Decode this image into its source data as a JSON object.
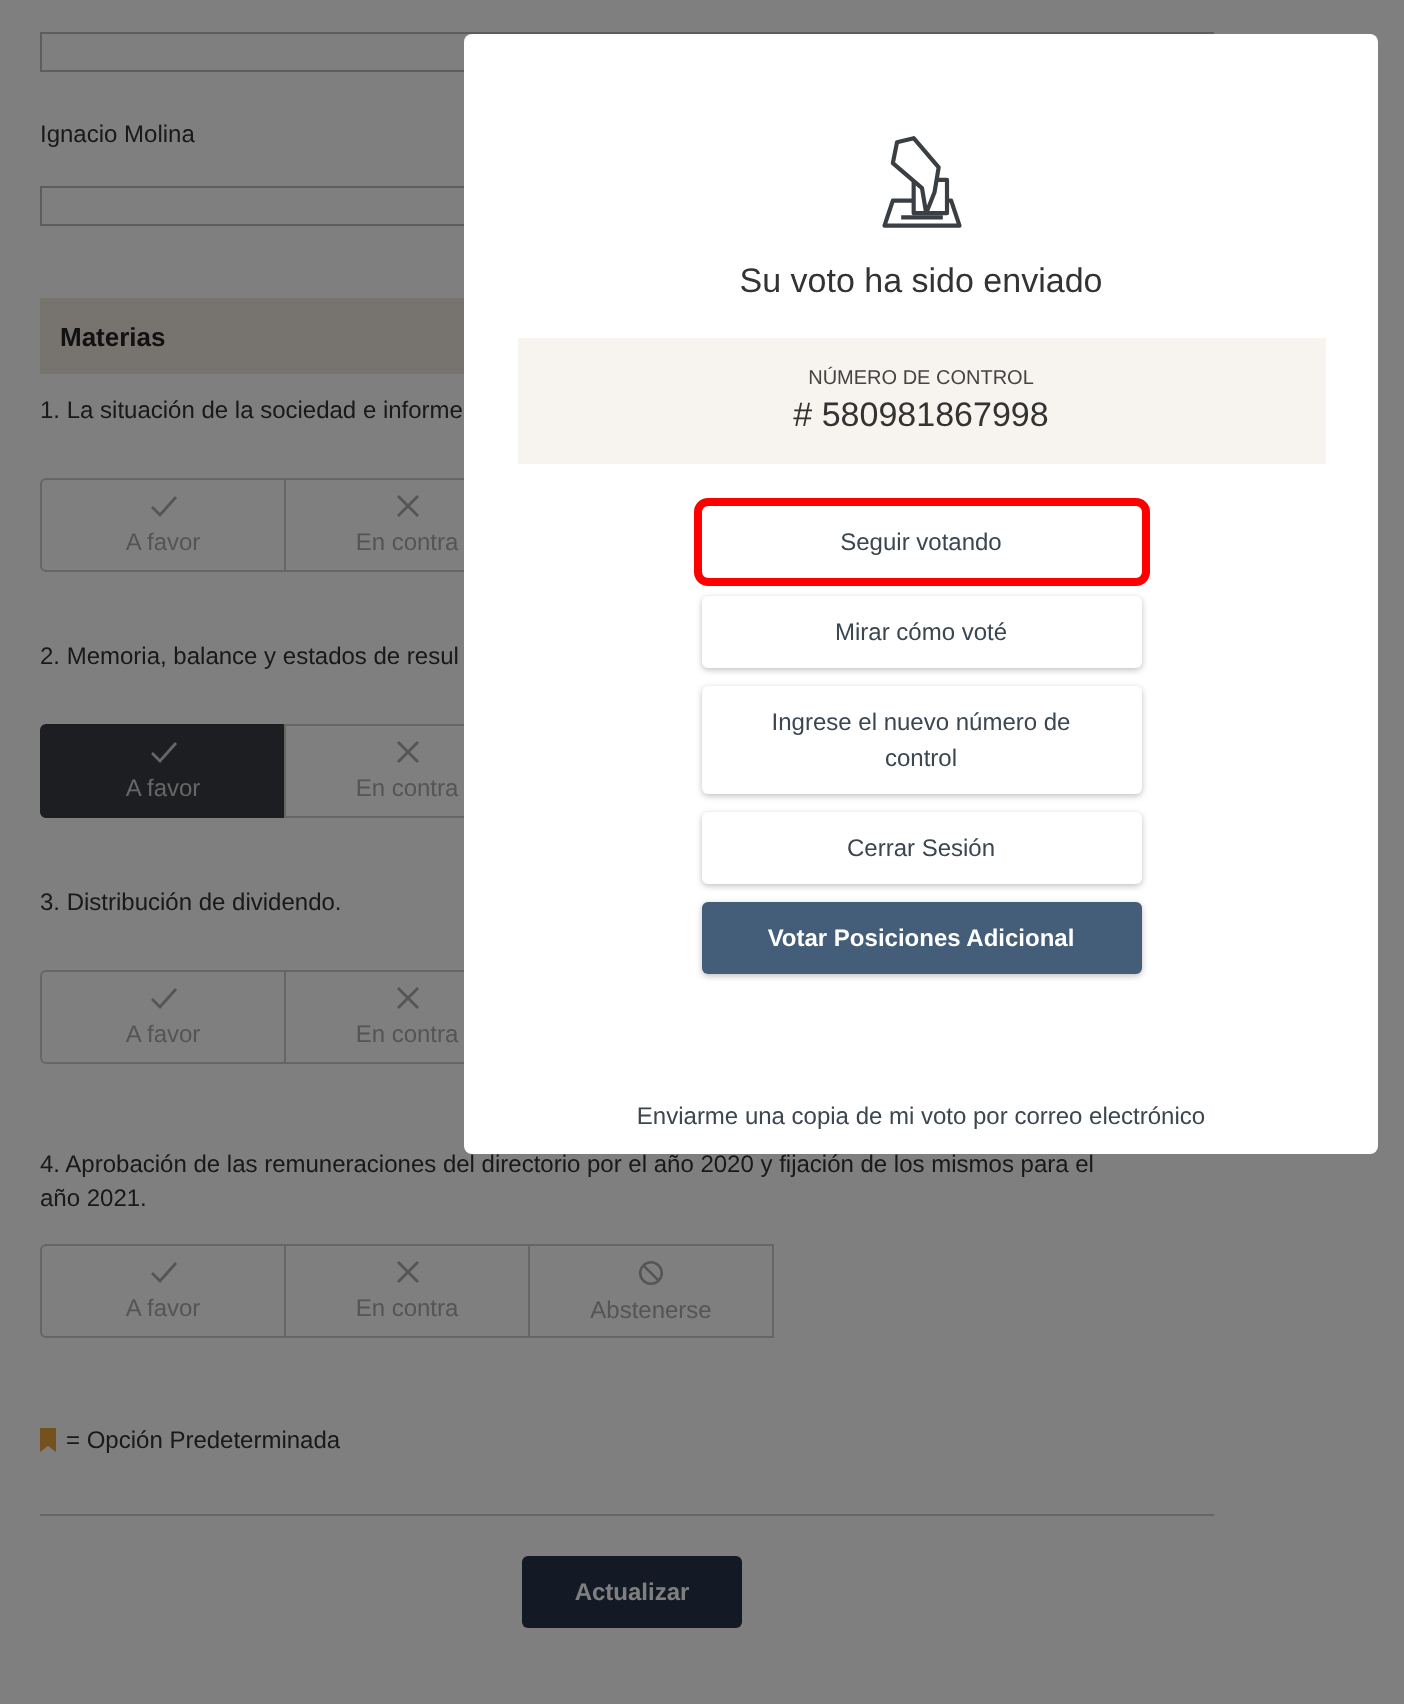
{
  "form": {
    "name_label": "Ignacio Molina",
    "section_title": "Materias",
    "questions": [
      {
        "text": "1. La situación de la sociedad e informe",
        "options": [
          {
            "kind": "favor",
            "label": "A favor",
            "selected": false
          },
          {
            "kind": "against",
            "label": "En contra",
            "selected": false
          }
        ]
      },
      {
        "text": "2. Memoria, balance y estados de resul",
        "options": [
          {
            "kind": "favor",
            "label": "A favor",
            "selected": true
          },
          {
            "kind": "against",
            "label": "En contra",
            "selected": false
          }
        ]
      },
      {
        "text": "3. Distribución de dividendo.",
        "options": [
          {
            "kind": "favor",
            "label": "A favor",
            "selected": false
          },
          {
            "kind": "against",
            "label": "En contra",
            "selected": false
          }
        ]
      },
      {
        "text": "4. Aprobación de las remuneraciones del directorio por el año 2020 y fijación de los mismos para el año 2021.",
        "options": [
          {
            "kind": "favor",
            "label": "A favor",
            "selected": false
          },
          {
            "kind": "against",
            "label": "En contra",
            "selected": false
          },
          {
            "kind": "abstain",
            "label": "Abstenerse",
            "selected": false
          }
        ]
      }
    ],
    "legend": "= Opción Predeterminada",
    "submit": "Actualizar"
  },
  "modal": {
    "title": "Su voto ha sido enviado",
    "control_label": "NÚMERO DE CONTROL",
    "control_number": "# 580981867998",
    "buttons": [
      {
        "kind": "secondary",
        "label": "Seguir votando",
        "highlighted": true
      },
      {
        "kind": "secondary",
        "label": "Mirar cómo voté",
        "highlighted": false
      },
      {
        "kind": "secondary",
        "label": "Ingrese el nuevo número de control",
        "highlighted": false
      },
      {
        "kind": "secondary",
        "label": "Cerrar Sesión",
        "highlighted": false
      },
      {
        "kind": "primary",
        "label": "Votar Posiciones Adicional",
        "highlighted": false
      }
    ],
    "email_link": "Enviarme una copia de mi voto por correo electrónico"
  }
}
